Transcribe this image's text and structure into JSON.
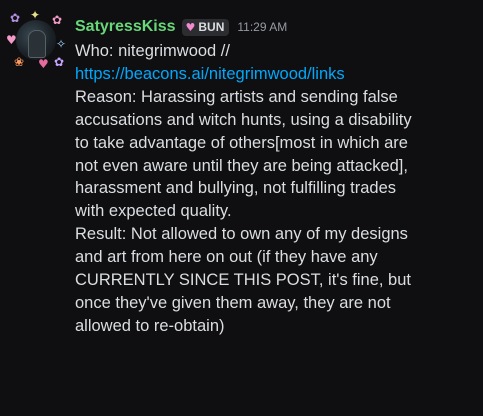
{
  "message": {
    "author": "SatyressKiss",
    "author_color": "#67d77a",
    "tag": {
      "icon": "heart-icon",
      "label": "BUN"
    },
    "timestamp": "11:29 AM",
    "who_line": "Who: nitegrimwood //",
    "link": "https://beacons.ai/nitegrimwood/links",
    "link_color": "#00a8fc",
    "reason_lines": [
      "Reason: Harassing artists and sending false",
      "accusations and witch hunts, using a disability",
      "to take advantage of others[most in which are",
      "not even aware until they are being attacked],",
      "harassment and bullying, not fulfilling trades",
      "with expected quality."
    ],
    "result_lines": [
      "Result: Not allowed to own any of my designs",
      "and art from here on out (if they have any",
      "CURRENTLY SINCE THIS POST, it's fine, but",
      "once they've given them away, they are not",
      "allowed to re-obtain)"
    ]
  },
  "colors": {
    "background": "#0f0f11",
    "text": "#dbdee1",
    "muted": "#949ba4"
  }
}
